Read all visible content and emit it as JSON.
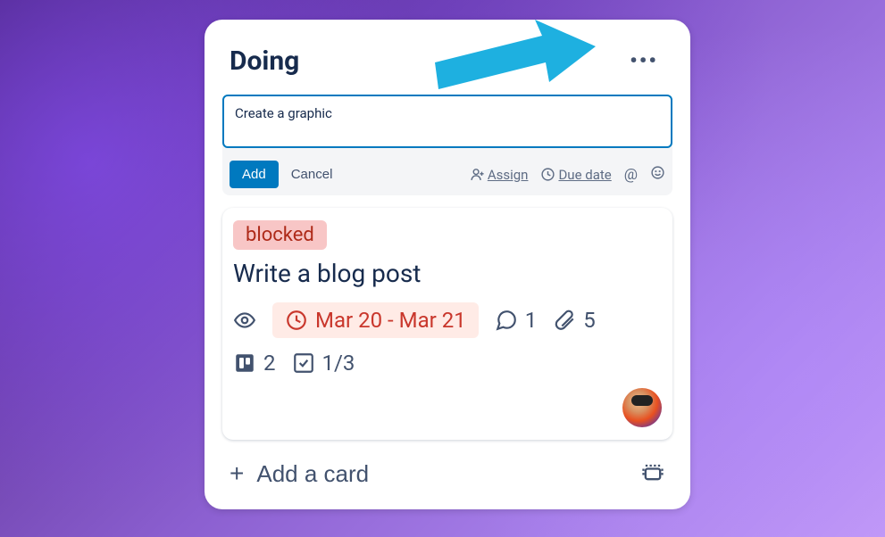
{
  "list": {
    "title": "Doing",
    "footer": {
      "add_card_label": "Add a card"
    }
  },
  "compose": {
    "input_value": "Create a graphic",
    "add_label": "Add",
    "cancel_label": "Cancel",
    "assign_label": "Assign",
    "due_label": "Due date"
  },
  "card": {
    "label": "blocked",
    "title": "Write a blog post",
    "due_text": "Mar 20 - Mar 21",
    "comments_count": "1",
    "attachments_count": "5",
    "trello_attachments_count": "2",
    "checklist_text": "1/3"
  }
}
